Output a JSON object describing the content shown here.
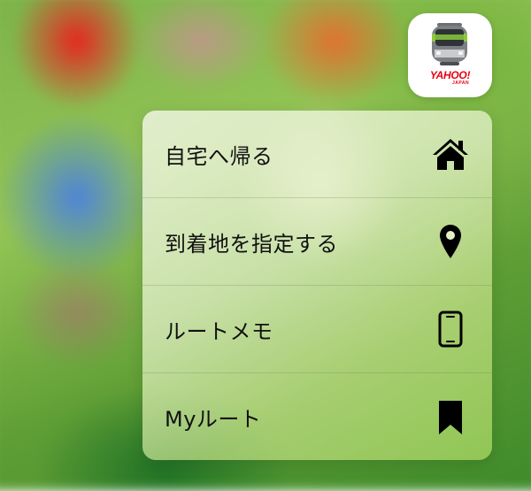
{
  "app_icon": {
    "brand_text": "YAHOO!",
    "brand_subtext": "JAPAN",
    "icon": "train-icon",
    "brand_color": "#e60012"
  },
  "quick_actions": [
    {
      "label": "自宅へ帰る",
      "icon": "home-icon"
    },
    {
      "label": "到着地を指定する",
      "icon": "location-pin-icon"
    },
    {
      "label": "ルートメモ",
      "icon": "smartphone-icon"
    },
    {
      "label": "Myルート",
      "icon": "bookmark-icon"
    }
  ]
}
